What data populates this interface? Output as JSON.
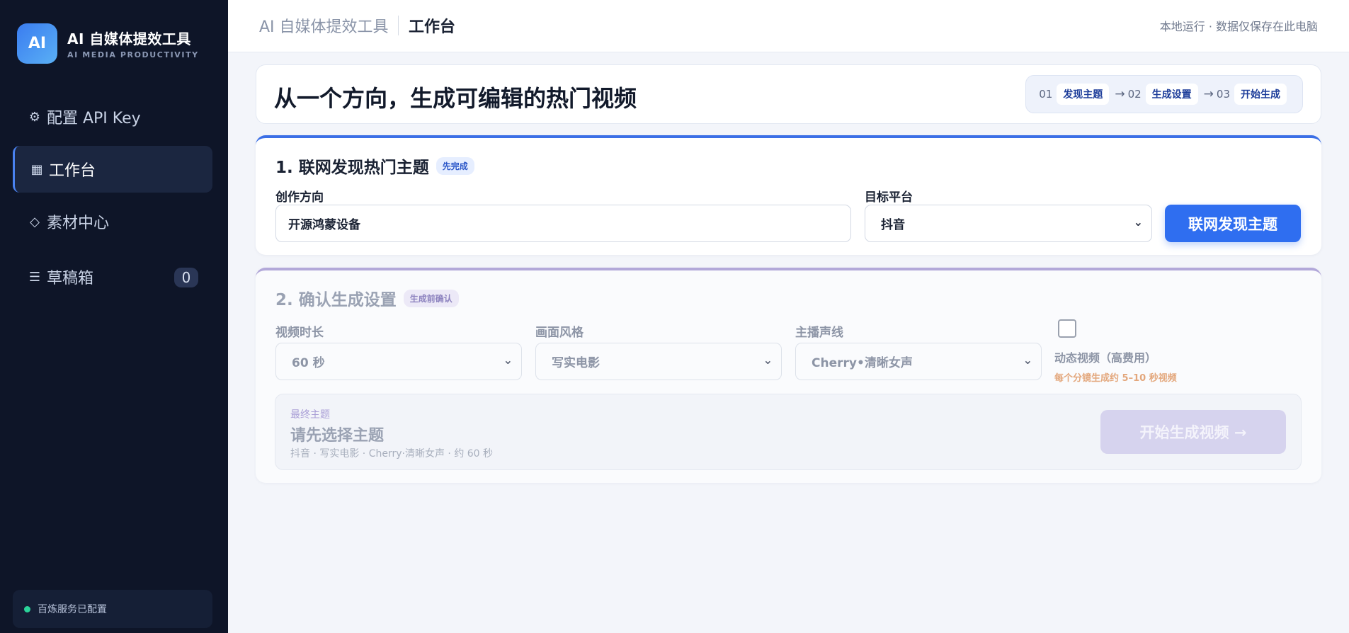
{
  "sidebar": {
    "logo_text": "AI",
    "brand_title": "AI 自媒体提效工具",
    "brand_subtitle": "AI MEDIA PRODUCTIVITY",
    "items": [
      {
        "icon": "gear-icon",
        "glyph": "⚙",
        "label": "配置 API Key",
        "active": false
      },
      {
        "icon": "grid-icon",
        "glyph": "▦",
        "label": "工作台",
        "active": true
      },
      {
        "icon": "diamond-icon",
        "glyph": "◇",
        "label": "素材中心",
        "active": false
      },
      {
        "icon": "list-icon",
        "glyph": "☰",
        "label": "草稿箱",
        "active": false,
        "badge": "0"
      }
    ],
    "status_text": "百炼服务已配置"
  },
  "header": {
    "app_name": "AI 自媒体提效工具",
    "page_title": "工作台",
    "note": "本地运行 · 数据仅保存在此电脑"
  },
  "hero": {
    "title": "从一个方向，生成可编辑的热门视频",
    "steps": [
      {
        "num": "01",
        "label": "发现主题"
      },
      {
        "num": "02",
        "label": "生成设置"
      },
      {
        "num": "03",
        "label": "开始生成"
      }
    ],
    "arrow": "→"
  },
  "section1": {
    "title": "1. 联网发现热门主题",
    "tag": "先完成",
    "direction_label": "创作方向",
    "direction_value": "开源鸿蒙设备",
    "platform_label": "目标平台",
    "platform_value": "抖音",
    "discover_button": "联网发现主题"
  },
  "section2": {
    "title": "2. 确认生成设置",
    "tag": "生成前确认",
    "duration_label": "视频时长",
    "duration_value": "60 秒",
    "style_label": "画面风格",
    "style_value": "写实电影",
    "voice_label": "主播声线",
    "voice_value": "Cherry•清晰女声",
    "dynamic_label": "动态视频（高费用）",
    "dynamic_note": "每个分镜生成约 5–10 秒视频",
    "final_label": "最终主题",
    "final_title": "请先选择主题",
    "final_meta": "抖音 · 写实电影 · Cherry·清晰女声 · 约 60 秒",
    "start_button": "开始生成视频 →"
  },
  "colors": {
    "sidebar_bg": "#0e1528",
    "accent": "#2f6ef0",
    "status_ok": "#2bd49a",
    "section2_accent": "#b2a8d9",
    "warning_note": "#e3a77c"
  }
}
